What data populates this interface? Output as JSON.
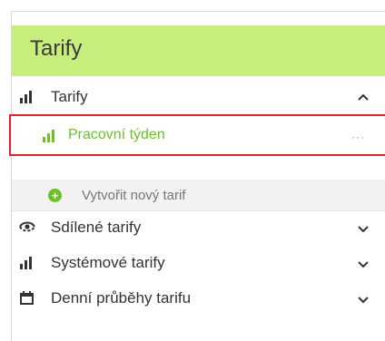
{
  "panel": {
    "title": "Tarify"
  },
  "tree": {
    "group": {
      "label": "Tarify",
      "icon": "bar-chart-icon",
      "expanded": true
    },
    "selected_item": {
      "label": "Pracovní týden",
      "icon": "bar-chart-icon",
      "more": "···"
    },
    "create": {
      "label": "Vytvořit nový tarif",
      "icon": "plus-circle-icon"
    },
    "other_groups": [
      {
        "label": "Sdílené tarify",
        "icon": "eye-icon"
      },
      {
        "label": "Systémové tarify",
        "icon": "bar-chart-icon"
      },
      {
        "label": "Denní průběhy tarifu",
        "icon": "calendar-icon"
      }
    ]
  },
  "colors": {
    "header_bg": "#c7ee7d",
    "accent_green": "#6cc02a",
    "selection_border": "#e0242f"
  }
}
